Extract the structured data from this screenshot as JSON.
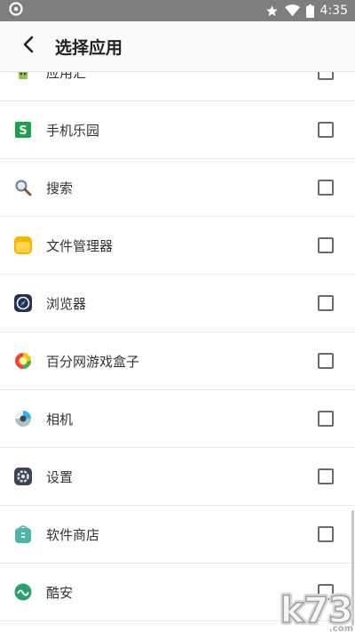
{
  "status_bar": {
    "time": "4:35"
  },
  "header": {
    "title": "选择应用"
  },
  "apps": [
    {
      "label": "应用汇",
      "icon": "yingyonghui-icon",
      "checked": false
    },
    {
      "label": "手机乐园",
      "icon": "shoujileyuan-icon",
      "checked": false
    },
    {
      "label": "搜索",
      "icon": "search-icon",
      "checked": false
    },
    {
      "label": "文件管理器",
      "icon": "file-manager-icon",
      "checked": false
    },
    {
      "label": "浏览器",
      "icon": "browser-icon",
      "checked": false
    },
    {
      "label": "百分网游戏盒子",
      "icon": "game-box-icon",
      "checked": false
    },
    {
      "label": "相机",
      "icon": "camera-icon",
      "checked": false
    },
    {
      "label": "设置",
      "icon": "settings-icon",
      "checked": false
    },
    {
      "label": "软件商店",
      "icon": "software-store-icon",
      "checked": false
    },
    {
      "label": "酷安",
      "icon": "coolapk-icon",
      "checked": false
    }
  ],
  "colors": {
    "status_bar": "#7e7e7e",
    "app_bar": "#fafafa",
    "divider": "#e8e8e8",
    "checkbox_border": "#6b6b6b"
  },
  "watermark": {
    "text": "k73.com"
  }
}
